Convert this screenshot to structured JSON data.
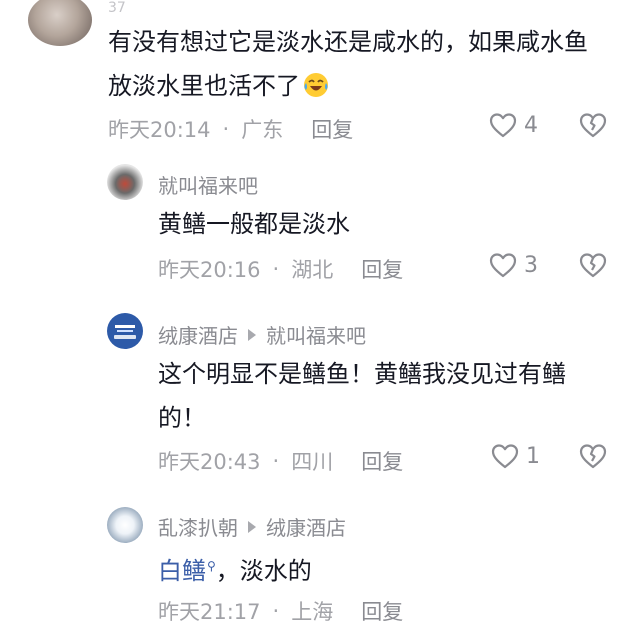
{
  "comments": [
    {
      "stub": "37",
      "text": "有没有想过它是淡水还是咸水的，如果咸水鱼放淡水里也活不了",
      "emoji": "crying-laughing-emoji",
      "time": "昨天20:14",
      "location": "广东",
      "reply_label": "回复",
      "likes": "4"
    },
    {
      "author": "就叫福来吧",
      "text": "黄鳝一般都是淡水",
      "time": "昨天20:16",
      "location": "湖北",
      "reply_label": "回复",
      "likes": "3"
    },
    {
      "author": "绒康酒店",
      "reply_to": "就叫福来吧",
      "text_line1": "这个明显不是鳝鱼！黄鳝我没见过有鳝",
      "text_line2": "的！",
      "time": "昨天20:43",
      "location": "四川",
      "reply_label": "回复",
      "likes": "1"
    },
    {
      "author": "乱漆扒朝",
      "reply_to": "绒康酒店",
      "link_text": "白鳝",
      "text_rest": "，淡水的",
      "time": "昨天21:17",
      "location": "上海",
      "reply_label": "回复"
    }
  ],
  "colors": {
    "text": "#161823",
    "meta": "#a1a2a7",
    "link": "#3b5ea8"
  }
}
